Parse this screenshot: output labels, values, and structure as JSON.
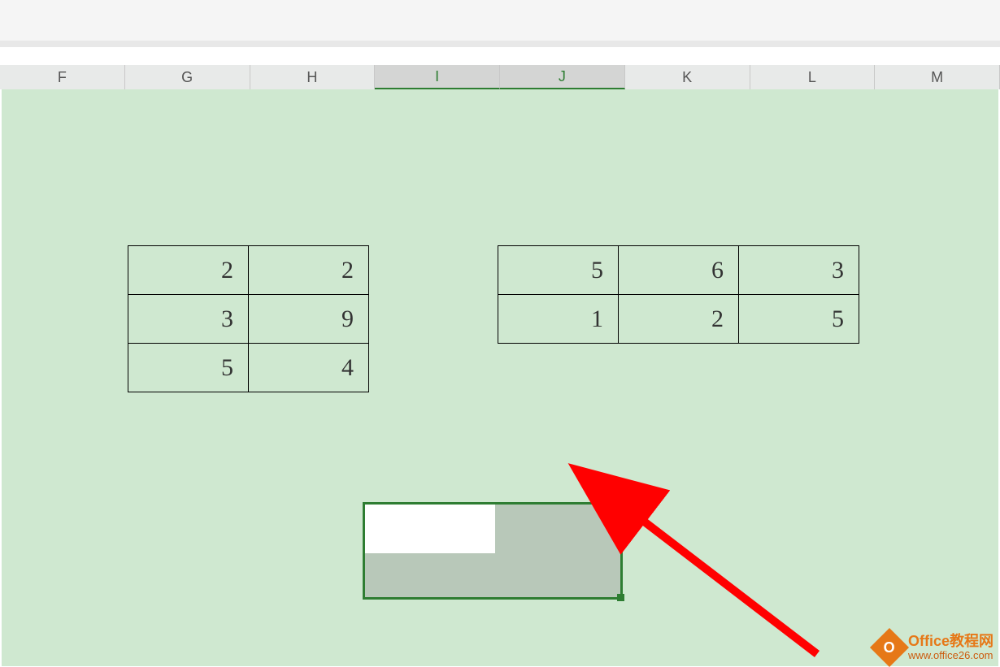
{
  "columns": [
    "F",
    "G",
    "H",
    "I",
    "J",
    "K",
    "L",
    "M"
  ],
  "selected_columns": [
    "I",
    "J"
  ],
  "table1": [
    [
      2,
      2
    ],
    [
      3,
      9
    ],
    [
      5,
      4
    ]
  ],
  "table2": [
    [
      5,
      6,
      3
    ],
    [
      1,
      2,
      5
    ]
  ],
  "watermark": {
    "icon_letter": "O",
    "line1": "Office教程网",
    "line2": "www.office26.com"
  }
}
